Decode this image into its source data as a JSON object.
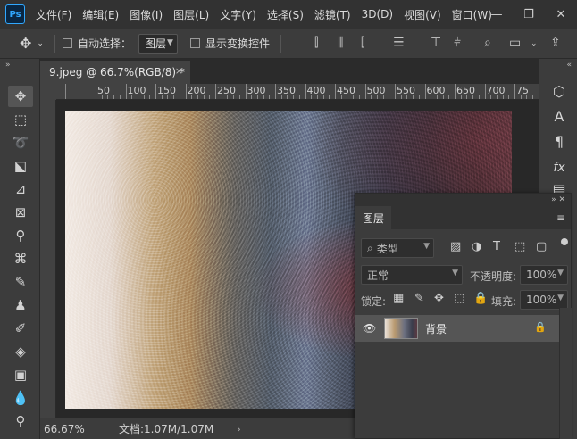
{
  "menubar": {
    "logo": "Ps",
    "items": [
      "文件(F)",
      "编辑(E)",
      "图像(I)",
      "图层(L)",
      "文字(Y)",
      "选择(S)",
      "滤镜(T)",
      "3D(D)",
      "视图(V)",
      "窗口(W)"
    ],
    "controls": [
      "—",
      "❐",
      "✕"
    ]
  },
  "options": {
    "move_icon": "move-icon",
    "auto_select_label": "自动选择：",
    "target_value": "图层",
    "show_transform_label": "显示变换控件"
  },
  "document": {
    "tab_title": "9.jpeg @ 66.7%(RGB/8) *",
    "close": "×"
  },
  "ruler": {
    "labels": [
      "50",
      "100",
      "150",
      "200",
      "250",
      "300",
      "350",
      "400",
      "450",
      "500",
      "550",
      "600",
      "650",
      "700",
      "75"
    ]
  },
  "status": {
    "zoom": "66.67%",
    "doc_info": "文档:1.07M/1.07M",
    "arrow": "›"
  },
  "layers_panel": {
    "tab": "图层",
    "filter_type": "类型",
    "blend_mode": "正常",
    "opacity_label": "不透明度:",
    "opacity_value": "100%",
    "lock_label": "锁定:",
    "fill_label": "填充:",
    "fill_value": "100%",
    "layers": [
      {
        "name": "背景",
        "visible": true,
        "locked": true
      }
    ]
  },
  "colors": {
    "accent": "#31a8ff",
    "panel": "#3c3c3c",
    "menubar": "#323232",
    "canvas_bg": "#282828"
  }
}
